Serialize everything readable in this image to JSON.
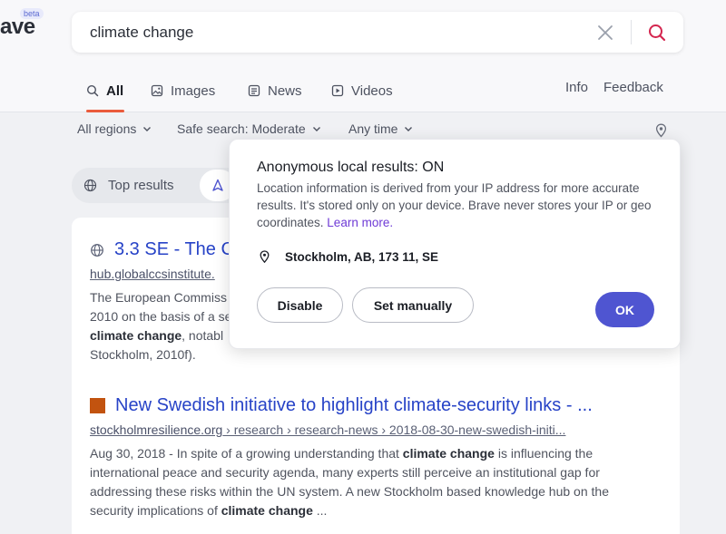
{
  "brand": {
    "logo_text": "ave",
    "beta_label": "beta"
  },
  "search": {
    "query": "climate change",
    "placeholder": ""
  },
  "tabs": [
    {
      "label": "All",
      "icon": "search-icon",
      "active": true
    },
    {
      "label": "Images",
      "icon": "image-icon"
    },
    {
      "label": "News",
      "icon": "news-icon"
    },
    {
      "label": "Videos",
      "icon": "video-icon"
    }
  ],
  "top_links": {
    "info": "Info",
    "feedback": "Feedback"
  },
  "filters": {
    "region": "All regions",
    "safe_search": "Safe search: Moderate",
    "time": "Any time"
  },
  "pills": {
    "top_results": "Top results"
  },
  "results": [
    {
      "title": "3.3 SE - The C",
      "url_host": "hub.globalccsinstitute.",
      "url_path": "",
      "desc_parts": [
        "The European Commiss",
        "2010 on the basis of a se",
        "climate change",
        ", notabl",
        "Stockholm, 2010f)."
      ]
    },
    {
      "title": "New Swedish initiative to highlight climate-security links - ...",
      "url_host": "stockholmresilience.org",
      "url_path": " › research › research-news › 2018-08-30-new-swedish-initi...",
      "desc_parts": [
        "Aug 30, 2018 - In spite of a growing understanding that ",
        "climate change",
        " is influencing the international peace and security agenda, many experts still perceive an institutional gap for addressing these risks within the UN system. A new Stockholm based knowledge hub on the security implications of ",
        "climate change",
        " ..."
      ]
    }
  ],
  "popover": {
    "title": "Anonymous local results: ON",
    "body": "Location information is derived from your IP address for more accurate results. It's stored only on your device. Brave never stores your IP or geo coordinates. ",
    "learn_more": "Learn more.",
    "location": "Stockholm, AB, 173 11, SE",
    "disable_label": "Disable",
    "set_manually_label": "Set manually",
    "ok_label": "OK"
  },
  "colors": {
    "accent": "#ea5b3c",
    "primary_button": "#4f55d1",
    "link": "#2743c7",
    "learn_more": "#6f3bd6",
    "favicon_square": "#c2530f"
  }
}
